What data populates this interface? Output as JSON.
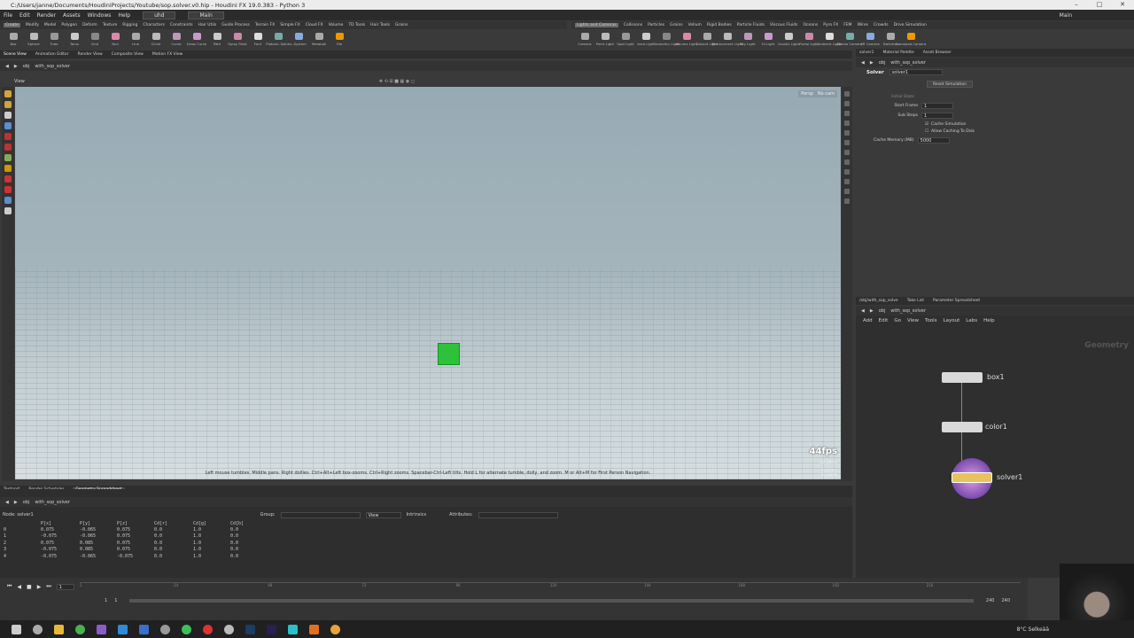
{
  "window": {
    "title": "C:/Users/janne/Documents/HoudiniProjects/Youtube/sop.solver.v0.hip - Houdini FX 19.0.383 - Python 3",
    "controls": [
      "–",
      "□",
      "✕"
    ]
  },
  "menubar": {
    "items": [
      "File",
      "Edit",
      "Render",
      "Assets",
      "Windows",
      "Help"
    ],
    "desktop_left": "uhd",
    "desktop_right": "Main",
    "right_label": "Main"
  },
  "shelf_tabs_left": [
    "Create",
    "Modify",
    "Model",
    "Polygon",
    "Deform",
    "Texture",
    "Rigging",
    "Characters",
    "Constraints",
    "Hair Utils",
    "Guide Process",
    "Terrain FX",
    "Simple FX",
    "Cloud FX",
    "Volume",
    "TD Tools",
    "Hair Tools",
    "Grains"
  ],
  "shelf_tabs_right": [
    "Lights and Cameras",
    "Collisions",
    "Particles",
    "Grains",
    "Vellum",
    "Rigid Bodies",
    "Particle Fluids",
    "Viscous Fluids",
    "Oceans",
    "Pyro FX",
    "FEM",
    "Wires",
    "Crowds",
    "Drive Simulation"
  ],
  "shelf_tools_left": [
    "Box",
    "Sphere",
    "Tube",
    "Torus",
    "Grid",
    "Null",
    "Line",
    "Circle",
    "Curve",
    "Draw Curve",
    "Path",
    "Spray Paint",
    "Font",
    "Platonic Solids",
    "L-System",
    "Metaball",
    "File"
  ],
  "shelf_tools_right": [
    "Camera",
    "Point Light",
    "Spot Light",
    "Area Light",
    "Geometry Light",
    "Volume Light",
    "Distant Light",
    "Environment Light",
    "Sky Light",
    "GI Light",
    "Caustic Light",
    "Portal Light",
    "Ambient Light",
    "Stereo Camera",
    "VR Camera",
    "Switcher",
    "Gamepad Camera"
  ],
  "viewer_tabs": [
    "Scene View",
    "Animation Editor",
    "Render View",
    "Composite View",
    "Motion FX View"
  ],
  "viewer_path": [
    "obj",
    "with_sop_solver"
  ],
  "viewport": {
    "label": "View",
    "persp": "Persp",
    "cam": "No cam",
    "fps": "44fps",
    "fps_sub": "22.58ms",
    "stats": "6 prims\n8 points",
    "hint": "Left mouse tumbles. Middle pans. Right dollies. Ctrl+Alt+Left box-zooms. Ctrl+Right zooms. Spacebar-Ctrl-Left tilts. Hold L for alternate tumble, dolly, and zoom.    M or Alt+M for First Person Navigation.",
    "cube_color": "#2ec23c"
  },
  "bottom_tabs": [
    "Textport",
    "Render Scheduler",
    "Geometry Spreadsheet"
  ],
  "spreadsheet": {
    "path": [
      "obj",
      "with_sop_solver"
    ],
    "node_label": "Node: solver1",
    "group_label": "Group:",
    "view_label": "View",
    "intrinsics_label": "Intrinsics",
    "attributes_label": "Attributes:",
    "columns": [
      "",
      "P[x]",
      "P[y]",
      "P[z]",
      "Cd[r]",
      "Cd[g]",
      "Cd[b]"
    ],
    "rows": [
      [
        "0",
        "0.075",
        "-0.065",
        "0.075",
        "0.0",
        "1.0",
        "0.0"
      ],
      [
        "1",
        "-0.075",
        "-0.065",
        "0.075",
        "0.0",
        "1.0",
        "0.0"
      ],
      [
        "2",
        "0.075",
        "0.085",
        "0.075",
        "0.0",
        "1.0",
        "0.0"
      ],
      [
        "3",
        "-0.075",
        "0.085",
        "0.075",
        "0.0",
        "1.0",
        "0.0"
      ],
      [
        "4",
        "-0.075",
        "-0.065",
        "-0.075",
        "0.0",
        "1.0",
        "0.0"
      ]
    ]
  },
  "timeline": {
    "frame": "1",
    "start": "1",
    "range_start": "1",
    "end_a": "240",
    "end_b": "240",
    "ticks": [
      "1",
      "24",
      "48",
      "72",
      "96",
      "120",
      "144",
      "168",
      "192",
      "216"
    ]
  },
  "parm_pane": {
    "tabs": [
      "solver1",
      "Material Palette",
      "Asset Browser"
    ],
    "path": [
      "obj",
      "with_sop_solver"
    ],
    "node_type": "Solver",
    "node_name": "solver1",
    "reset_button": "Reset Simulation",
    "initial_state_label": "Initial State",
    "start_frame_label": "Start Frame",
    "start_frame_value": "1",
    "sub_steps_label": "Sub Steps",
    "sub_steps_value": "1",
    "cache_sim_label": "Cache Simulation",
    "allow_cache_label": "Allow Caching To Disk",
    "cache_mem_label": "Cache Memory (MB)",
    "cache_mem_value": "5000"
  },
  "network_pane": {
    "tabs": [
      "/obj/with_sop_solve",
      "Take List",
      "Parameter Spreadsheet"
    ],
    "path": [
      "obj",
      "with_sop_solver"
    ],
    "menu": [
      "Add",
      "Edit",
      "Go",
      "View",
      "Tools",
      "Layout",
      "Labs",
      "Help"
    ],
    "context_label": "Geometry",
    "nodes": [
      {
        "name": "box1"
      },
      {
        "name": "color1"
      },
      {
        "name": "solver1"
      }
    ]
  },
  "taskbar": {
    "weather": "8°C Selkeää",
    "icons": [
      "windows",
      "search",
      "explorer",
      "chrome",
      "vs",
      "vscode",
      "vs-blue",
      "steam",
      "whatsapp",
      "media",
      "settings",
      "photoshop",
      "after-effects",
      "mail",
      "houdini",
      "blender"
    ]
  }
}
